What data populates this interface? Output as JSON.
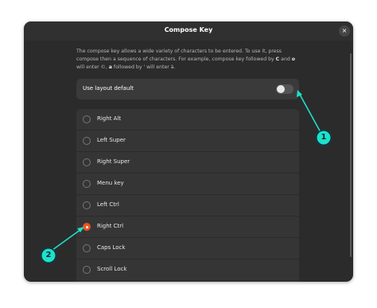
{
  "dialog": {
    "title": "Compose Key",
    "close_glyph": "×",
    "description": {
      "part1": "The compose key allows a wide variety of characters to be entered. To use it, press compose then a sequence of characters.  For example, compose key followed by ",
      "key1": "C",
      "part2": " and ",
      "key2": "o",
      "part3": " will enter ©, ",
      "key3": "a",
      "part4": " followed by ' will enter à."
    },
    "toggle": {
      "label": "Use layout default",
      "on": false
    }
  },
  "options": [
    {
      "label": "Right Alt",
      "selected": false
    },
    {
      "label": "Left Super",
      "selected": false
    },
    {
      "label": "Right Super",
      "selected": false
    },
    {
      "label": "Menu key",
      "selected": false
    },
    {
      "label": "Left Ctrl",
      "selected": false
    },
    {
      "label": "Right Ctrl",
      "selected": true
    },
    {
      "label": "Caps Lock",
      "selected": false
    },
    {
      "label": "Scroll Lock",
      "selected": false
    }
  ],
  "annotations": [
    {
      "number": "1"
    },
    {
      "number": "2"
    }
  ],
  "colors": {
    "accent": "#e95420",
    "callout": "#1de1c8",
    "dialog_bg": "#2b2b2b"
  },
  "icons": {
    "close": "close-icon"
  }
}
